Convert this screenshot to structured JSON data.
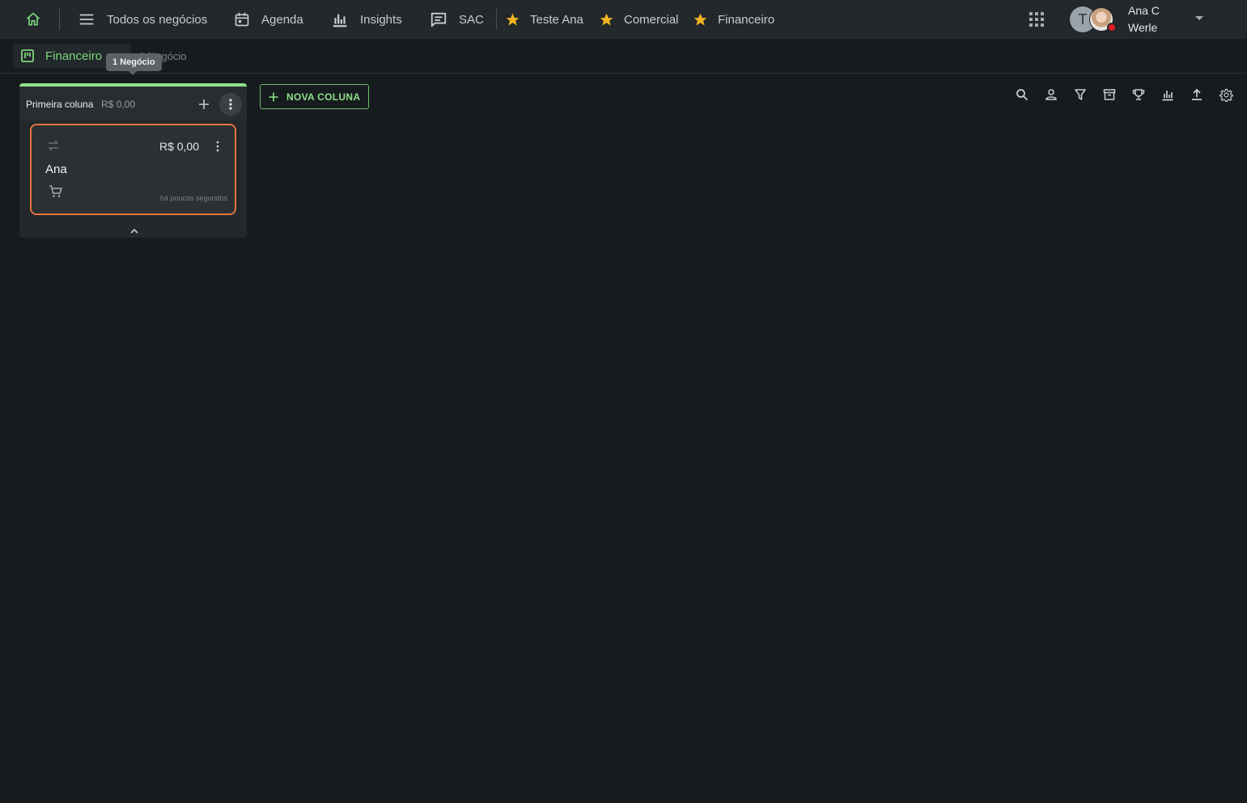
{
  "topbar": {
    "nav": [
      {
        "label": "Todos os negócios",
        "icon": "menu-icon"
      },
      {
        "label": "Agenda",
        "icon": "calendar-icon"
      },
      {
        "label": "Insights",
        "icon": "bar-chart-icon"
      },
      {
        "label": "SAC",
        "icon": "chat-icon"
      }
    ],
    "favorites": [
      {
        "label": "Teste Ana",
        "icon": "star-icon"
      },
      {
        "label": "Comercial",
        "icon": "star-icon"
      },
      {
        "label": "Financeiro",
        "icon": "star-icon"
      }
    ],
    "user": {
      "initial": "T",
      "name": "Ana C Werle",
      "status_color": "#e01b24"
    }
  },
  "subbar": {
    "board_name": "Financeiro",
    "count_text": "1 Negócio",
    "tooltip": "1 Negócio"
  },
  "column": {
    "name": "Primeira coluna",
    "total": "R$ 0,00",
    "accent": "#8ee28a"
  },
  "card": {
    "value": "R$ 0,00",
    "title": "Ana",
    "time": "há poucos segundos",
    "border_color": "#e8733f"
  },
  "new_column": {
    "label": "NOVA COLUNA"
  },
  "colors": {
    "accent_green": "#7ed67c",
    "star": "#f2b521",
    "background": "#161b1e"
  }
}
